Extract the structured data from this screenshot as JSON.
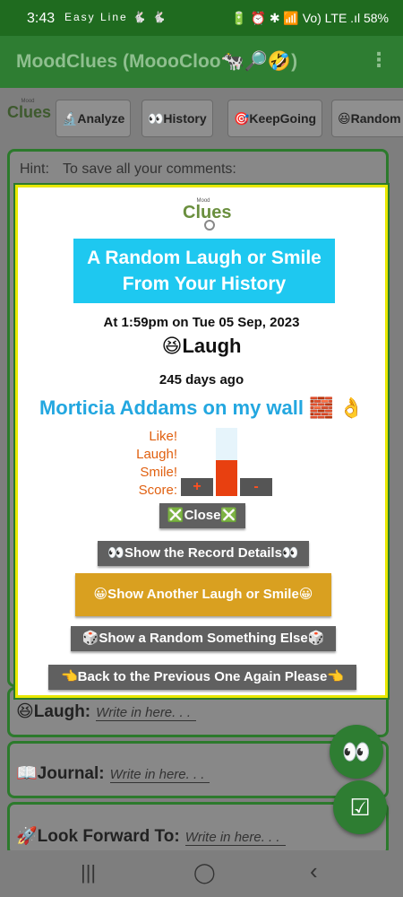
{
  "status_bar": {
    "time": "3:43",
    "left_icons": "Easy Line 🐇 🐇",
    "right_icons": "🔋 ⏰ ✱ 📶 Vo) LTE .ıl",
    "battery": "58%"
  },
  "app_bar": {
    "title": "MoodClues (MoooCloo🐄🔎🤣)",
    "menu_icon": "more-vert-icon"
  },
  "tabs": {
    "logo_small": "Mood",
    "logo_main": "Clues",
    "items": [
      {
        "label": "🔬Analyze"
      },
      {
        "label": "👀History"
      },
      {
        "label": "🎯KeepGoing"
      },
      {
        "label": "😆Random"
      }
    ]
  },
  "background": {
    "hint_label": "Hint:",
    "hint_text": "To save all your comments:",
    "entries": [
      {
        "label": "😆Laugh:",
        "placeholder": "Write in here. . ."
      },
      {
        "label": "📖Journal:",
        "placeholder": "Write in here. . ."
      },
      {
        "label": "🚀Look Forward To:",
        "placeholder": "Write in here. . ."
      }
    ],
    "fab_eyes": "👀",
    "fab_check": "☑"
  },
  "dialog": {
    "logo_small": "Mood",
    "logo_main": "Clues",
    "title_line1": "A Random Laugh or Smile",
    "title_line2": "From Your History",
    "date": "At 1:59pm on Tue 05 Sep, 2023",
    "type": "😆Laugh",
    "ago": "245 days ago",
    "comment": "Morticia Addams on my wall 🧱 👌",
    "score_labels": [
      "Like!",
      "Laugh!",
      "Smile!",
      "Score:"
    ],
    "score_fraction": 0.52,
    "plus_label": "+",
    "minus_label": "-",
    "close_label": "❎Close❎",
    "details_label": "👀Show the Record Details👀",
    "another_label": "😀Show Another Laugh or Smile😀",
    "random_label": "🎲Show a Random Something Else🎲",
    "back_label": "👈Back to the Previous One Again Please👈",
    "colors": {
      "banner": "#1ec8f0",
      "comment": "#23a7e0",
      "score_fill": "#e84010",
      "another_button": "#d9a020",
      "dialog_border": "#e8e800"
    }
  },
  "nav_bar": {
    "recent": "|||",
    "home": "◯",
    "back": "‹"
  }
}
